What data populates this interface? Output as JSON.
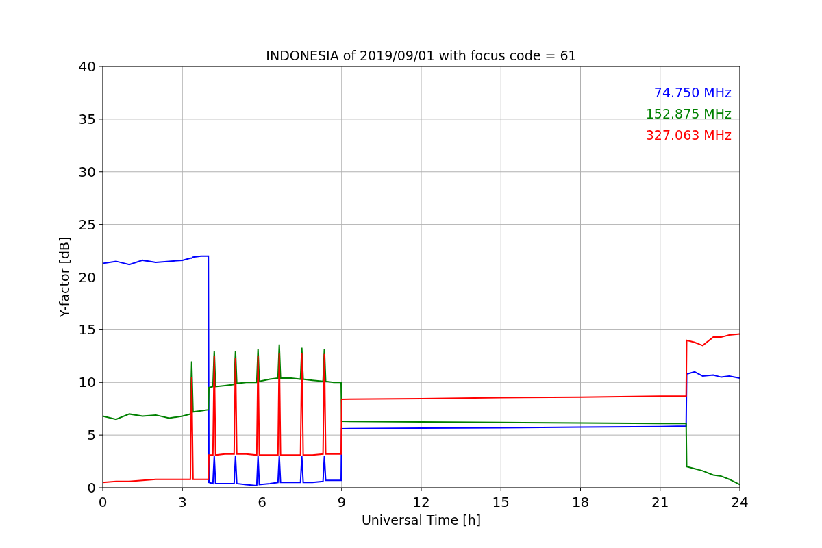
{
  "figure": {
    "chart_data": {
      "type": "line",
      "title": "INDONESIA of 2019/09/01 with focus code = 61",
      "xlabel": "Universal Time [h]",
      "ylabel": "Y-factor [dB]",
      "x": [
        0,
        0.5,
        1,
        1.5,
        2,
        2.5,
        3,
        3.3,
        3.35,
        3.4,
        3.7,
        3.98,
        4.0,
        4.15,
        4.2,
        4.25,
        4.6,
        4.95,
        5.0,
        5.05,
        5.4,
        5.8,
        5.85,
        5.9,
        6.3,
        6.6,
        6.65,
        6.7,
        7.1,
        7.45,
        7.5,
        7.55,
        7.9,
        8.3,
        8.35,
        8.4,
        8.7,
        8.98,
        9.0,
        12,
        15,
        18,
        21,
        21.98,
        22.0,
        22.3,
        22.6,
        23,
        23.3,
        23.6,
        24
      ],
      "series": [
        {
          "name": "74.750 MHz",
          "color": "#0000ff",
          "values": [
            21.3,
            21.5,
            21.2,
            21.6,
            21.4,
            21.5,
            21.6,
            21.8,
            21.8,
            21.9,
            22,
            22,
            0.5,
            0.4,
            3,
            0.4,
            0.4,
            0.4,
            3,
            0.4,
            0.3,
            0.2,
            3,
            0.3,
            0.4,
            0.5,
            3,
            0.5,
            0.5,
            0.5,
            3,
            0.5,
            0.5,
            0.6,
            3,
            0.7,
            0.7,
            0.7,
            5.6,
            5.65,
            5.7,
            5.75,
            5.8,
            5.85,
            10.8,
            11,
            10.6,
            10.7,
            10.5,
            10.6,
            10.4
          ]
        },
        {
          "name": "152.875 MHz",
          "color": "#008000",
          "values": [
            6.8,
            6.5,
            7,
            6.8,
            6.9,
            6.6,
            6.8,
            7,
            12,
            7.2,
            7.3,
            7.4,
            9.5,
            9.6,
            13,
            9.6,
            9.7,
            9.8,
            13,
            9.9,
            10,
            10,
            13.2,
            10.1,
            10.3,
            10.4,
            13.6,
            10.4,
            10.4,
            10.3,
            13.3,
            10.3,
            10.2,
            10.1,
            13.2,
            10.1,
            10,
            10,
            6.3,
            6.25,
            6.2,
            6.15,
            6.1,
            6.1,
            2,
            1.8,
            1.6,
            1.2,
            1.1,
            0.8,
            0.3
          ]
        },
        {
          "name": "327.063 MHz",
          "color": "#ff0000",
          "values": [
            0.5,
            0.6,
            0.6,
            0.7,
            0.8,
            0.8,
            0.8,
            0.8,
            10.5,
            0.8,
            0.8,
            0.8,
            3.1,
            3.1,
            12.5,
            3.1,
            3.2,
            3.2,
            12.3,
            3.2,
            3.2,
            3.1,
            12.5,
            3.1,
            3.1,
            3.1,
            12.8,
            3.1,
            3.1,
            3.1,
            12.8,
            3.1,
            3.1,
            3.2,
            12.7,
            3.2,
            3.2,
            3.2,
            8.4,
            8.45,
            8.55,
            8.6,
            8.7,
            8.7,
            14,
            13.8,
            13.5,
            14.3,
            14.3,
            14.5,
            14.6
          ]
        }
      ],
      "grid": true,
      "xlim": [
        0,
        24
      ],
      "ylim": [
        0,
        40
      ],
      "xticks": [
        0,
        3,
        6,
        9,
        12,
        15,
        18,
        21,
        24
      ],
      "yticks": [
        0,
        5,
        10,
        15,
        20,
        25,
        30,
        35,
        40
      ]
    }
  }
}
